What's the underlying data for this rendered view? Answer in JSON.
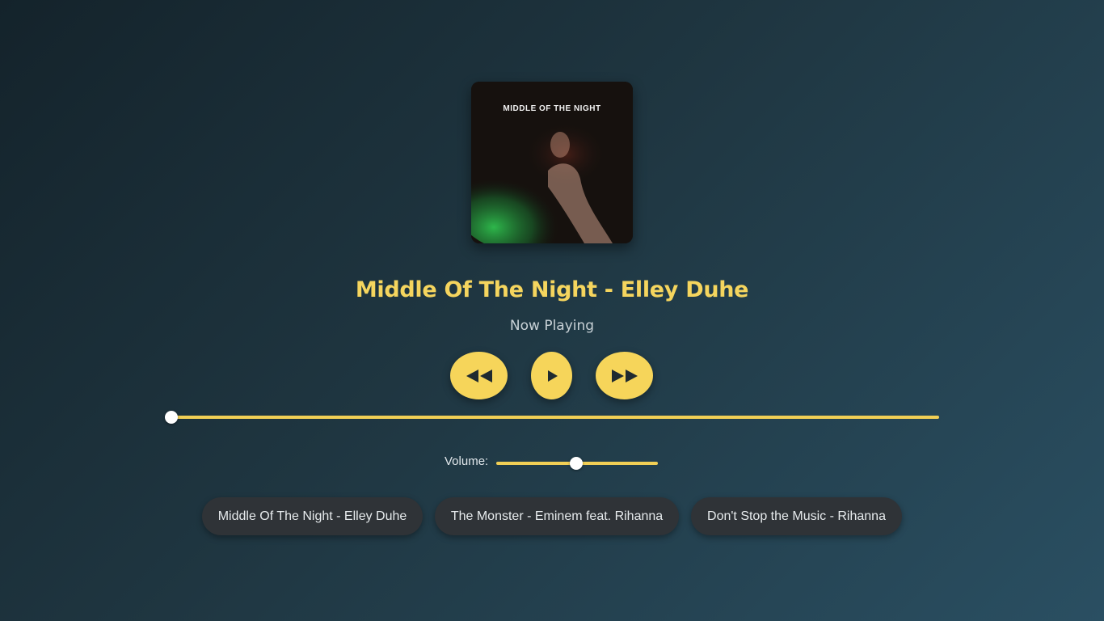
{
  "player": {
    "album_art_text": "MIDDLE OF THE NIGHT",
    "song_title": "Middle Of The Night - Elley Duhe",
    "status": "Now Playing",
    "progress": 0.0,
    "controls": {
      "prev_icon": "rewind-icon",
      "play_icon": "play-icon",
      "next_icon": "fast-forward-icon"
    },
    "volume": {
      "label": "Volume:",
      "value": 0.5
    }
  },
  "playlist": [
    {
      "label": "Middle Of The Night - Elley Duhe"
    },
    {
      "label": "The Monster - Eminem feat. Rihanna"
    },
    {
      "label": "Don't Stop the Music - Rihanna"
    }
  ],
  "colors": {
    "accent": "#f6d55a",
    "title": "#f5d55e",
    "background_start": "#14232b",
    "background_end": "#2a4f62",
    "pill": "#2f3337"
  }
}
